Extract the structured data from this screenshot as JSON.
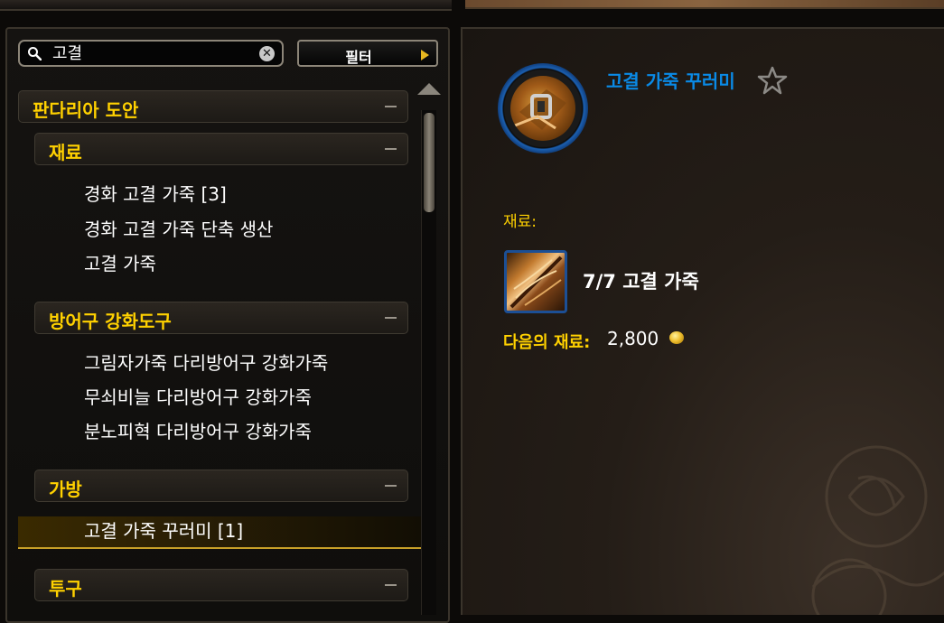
{
  "search": {
    "value": "고결",
    "placeholder": ""
  },
  "filter": {
    "label": "필터"
  },
  "categories": [
    {
      "label": "판다리아 도안"
    },
    {
      "label": "재료",
      "recipes": [
        "경화 고결 가죽 [3]",
        "경화 고결 가죽 단축 생산",
        "고결 가죽"
      ]
    },
    {
      "label": "방어구 강화도구",
      "recipes": [
        "그림자가죽 다리방어구 강화가죽",
        "무쇠비늘 다리방어구 강화가죽",
        "분노피혁 다리방어구 강화가죽"
      ]
    },
    {
      "label": "가방",
      "recipes": [
        "고결 가죽 꾸러미 [1]"
      ]
    },
    {
      "label": "투구"
    }
  ],
  "detail": {
    "item_name": "고결 가죽 꾸러미",
    "reagents_label": "재료:",
    "reagent": "7/7 고결 가죽",
    "next_label": "다음의 재료:",
    "next_value": "2,800"
  },
  "colors": {
    "category_gold": "#ffd100",
    "item_blue": "#0a8ae6",
    "selected_bar": "#c8a028"
  },
  "icons": [
    "search-icon",
    "clear-icon",
    "play-arrow-icon",
    "collapse-icon",
    "star-icon",
    "gold-coin-icon",
    "leather-bundle-icon",
    "leather-icon",
    "scroll-up-icon"
  ]
}
